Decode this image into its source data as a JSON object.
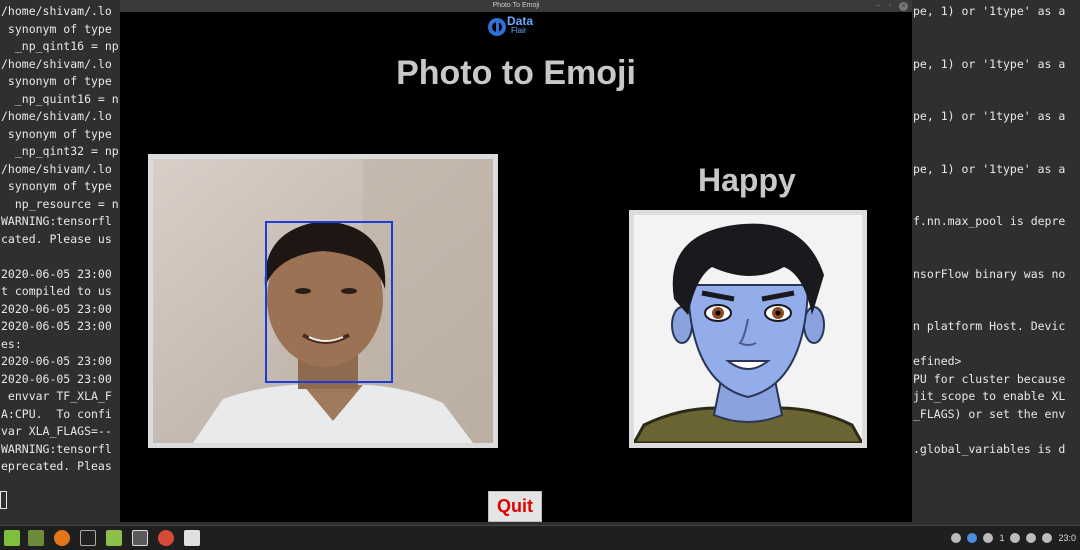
{
  "terminal": {
    "left_lines": [
      "/home/shivam/.lo",
      " synonym of type",
      "  _np_qint16 = np",
      "/home/shivam/.lo",
      " synonym of type",
      "  _np_quint16 = n",
      "/home/shivam/.lo",
      " synonym of type",
      "  _np_qint32 = np",
      "/home/shivam/.lo",
      " synonym of type",
      "  np_resource = n",
      "WARNING:tensorfl",
      "cated. Please us",
      "",
      "2020-06-05 23:00",
      "t compiled to us",
      "2020-06-05 23:00",
      "2020-06-05 23:00",
      "es:",
      "2020-06-05 23:00",
      "2020-06-05 23:00",
      " envvar TF_XLA_F",
      "A:CPU.  To confi",
      "var XLA_FLAGS=--",
      "WARNING:tensorfl",
      "eprecated. Pleas"
    ],
    "right_lines": [
      "pe, 1) or '1type' as a",
      "",
      "",
      "pe, 1) or '1type' as a",
      "",
      "",
      "pe, 1) or '1type' as a",
      "",
      "",
      "pe, 1) or '1type' as a",
      "",
      "",
      "f.nn.max_pool is depre",
      "",
      "",
      "nsorFlow binary was no",
      "",
      "",
      "n platform Host. Devic",
      "",
      "efined>",
      "PU for cluster because",
      "jit_scope to enable XL",
      "_FLAGS) or set the env",
      "",
      ".global_variables is d",
      ""
    ]
  },
  "window": {
    "title": "Photo To Emoji",
    "minimize": "–",
    "maximize": "▫",
    "close": "×"
  },
  "logo": {
    "line1": "Data",
    "line2": "Flair"
  },
  "app": {
    "title": "Photo to Emoji",
    "emotion": "Happy",
    "quit_label": "Quit"
  },
  "taskbar": {
    "clock": "23:0",
    "tray_count": "1"
  },
  "colors": {
    "face_box": "#1a3cd9",
    "quit_text": "#e00000",
    "title_text": "#c8c8c8"
  }
}
